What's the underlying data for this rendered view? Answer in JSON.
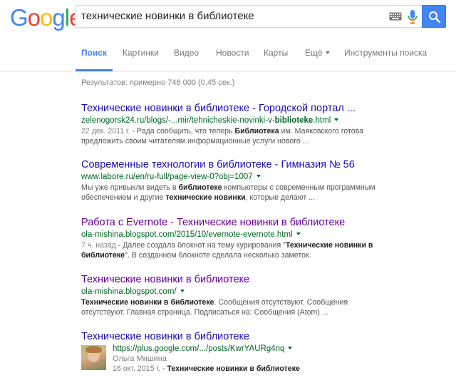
{
  "logo": {
    "letters": [
      "G",
      "o",
      "o",
      "g",
      "l",
      "e"
    ],
    "colors": [
      "#4285f4",
      "#ea4335",
      "#fbbc05",
      "#4285f4",
      "#34a853",
      "#ea4335"
    ]
  },
  "search": {
    "query": "технические новинки в библиотеке",
    "button_color": "#4285f4"
  },
  "tabs": [
    {
      "label": "Поиск",
      "active": true
    },
    {
      "label": "Картинки"
    },
    {
      "label": "Видео"
    },
    {
      "label": "Новости"
    },
    {
      "label": "Карты"
    },
    {
      "label": "Ещё"
    },
    {
      "label": "Инструменты поиска"
    }
  ],
  "stats": "Результатов: примерно 746 000 (0,45 сек.)",
  "results": [
    {
      "title": "Технические новинки в библиотеке - Городской портал ...",
      "url_prefix": "zelenogorsk24.ru/blogs/-...mir/tehnicheskie-novinki-v-",
      "url_bold": "biblioteke",
      "url_suffix": ".html",
      "date": "22 дек. 2011 г.",
      "snippet_1a": " - Рада сообщить, что теперь ",
      "snippet_1b": "Библиотека",
      "snippet_1c": " им. Маяковского готова",
      "snippet_2": "предложить своим читателям информационные услуги нового ..."
    },
    {
      "title": "Современные технологии в библиотеке - Гимназия № 56",
      "url": "www.labore.ru/en/ru-full/page-view-0?obj=1007",
      "snippet_1a": "Мы уже привыкли видеть в ",
      "snippet_1b": "библиотеке",
      "snippet_1c": " компьютеры с современным программным",
      "snippet_2a": "обеспечением и другие ",
      "snippet_2b": "технические новинки",
      "snippet_2c": ", которые делают ..."
    },
    {
      "title": "Работа с Evernote - Технические новинки в библиотеке",
      "url": "ola-mishina.blogspot.com/2015/10/evernote-evernote.html",
      "date": "7 ч. назад",
      "snippet_1a": " - Далее создала блокнот на тему курирования \"",
      "snippet_1b": "Технические новинки в",
      "snippet_2a": "библиотеке",
      "snippet_2b": "\". В созданном блокноте сделала несколько заметок."
    },
    {
      "title": "Технические новинки в библиотеке",
      "url": "ola-mishina.blogspot.com/",
      "snippet_1a": "Технические новинки в библиотеке",
      "snippet_1b": ". Сообщения отсутствуют. Сообщения",
      "snippet_2": "отсутствуют. Главная страница. Подписаться на: Сообщения (Atom) ..."
    },
    {
      "title": "Технические новинки в библиотеке",
      "url": "https://plus.google.com/.../posts/KwrYAURg4nq",
      "author": "Ольга Мишина",
      "date": "16 окт. 2015 г.",
      "snippet_a": " - ",
      "snippet_b": "Технические новинки в библиотеке"
    }
  ]
}
